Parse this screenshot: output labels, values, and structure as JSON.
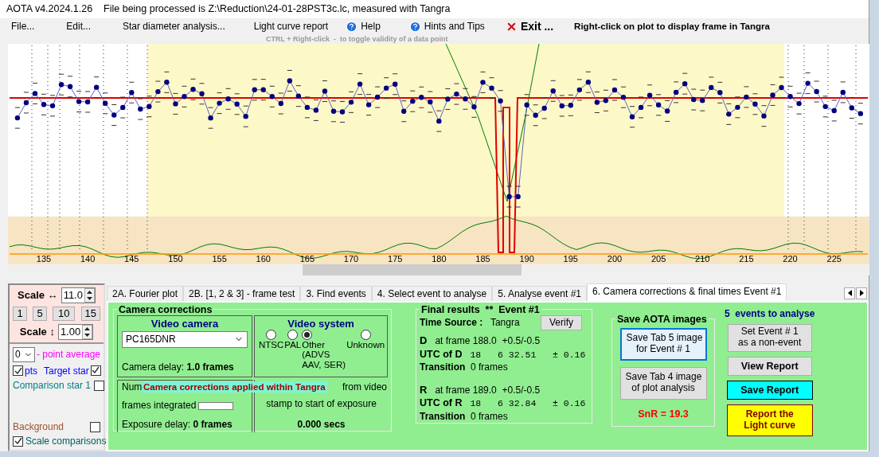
{
  "window": {
    "title": "AOTA v4.2024.1.26    File being processed is Z:\\Reduction\\24-01-28PST3c.lc, measured with Tangra"
  },
  "menu": [
    {
      "label": "File...",
      "kind": "plain"
    },
    {
      "label": "Edit...",
      "kind": "plain"
    },
    {
      "label": "Star diameter analysis...",
      "kind": "plain"
    },
    {
      "label": "Light curve report",
      "kind": "plain"
    },
    {
      "label": "Help",
      "kind": "help"
    },
    {
      "label": "Hints and Tips",
      "kind": "help"
    },
    {
      "label": "Exit ...",
      "kind": "exit"
    }
  ],
  "plot_hint": "Right-click on plot to display frame in Tangra",
  "toggle_hint": "CTRL + Right-click  -  to toggle validity of a data point",
  "plot": {
    "x_axis_labels": [
      "135",
      "140",
      "145",
      "150",
      "155",
      "160",
      "165",
      "170",
      "175",
      "180",
      "185",
      "190",
      "195",
      "200",
      "205",
      "210",
      "215",
      "220",
      "225"
    ]
  },
  "scale_panel": {
    "horizontal_label": "Scale ↔",
    "horizontal_value": "11.0",
    "presets": [
      "1",
      "5",
      "10",
      "15"
    ],
    "vertical_label": "Scale ↕",
    "vertical_value": "1.00"
  },
  "series_panel": {
    "point_average": "0",
    "point_average_label": "- point average",
    "pts_label": "pts",
    "pts_checked": true,
    "stars": [
      {
        "label": "Target star",
        "checked": true,
        "color": "#0000ff"
      },
      {
        "label": "Comparison star 1",
        "checked": false,
        "color": "#008080"
      },
      {
        "label": "Background",
        "checked": false,
        "color": "#a0522d"
      }
    ],
    "scale_comparisons": {
      "label": "Scale comparisons",
      "checked": true
    }
  },
  "tabs": [
    {
      "label": "2A. Fourier plot",
      "selected": false
    },
    {
      "label": "2B. [1, 2 & 3] - frame test",
      "selected": false
    },
    {
      "label": "3. Find events",
      "selected": false
    },
    {
      "label": "4. Select event to analyse",
      "selected": false
    },
    {
      "label": "5. Analyse event #1",
      "selected": false
    },
    {
      "label": "6. Camera corrections & final times Event #1",
      "selected": true
    }
  ],
  "camera_corrections": {
    "title": "Camera corrections",
    "video_camera": {
      "title": "Video camera",
      "value": "PC165DNR",
      "delay_label": "Camera delay:",
      "delay_value": "1.0 frames"
    },
    "video_system": {
      "title": "Video system",
      "options": [
        {
          "label": "NTSC",
          "selected": false
        },
        {
          "label": "PAL",
          "selected": false
        },
        {
          "label": "Other\n(ADVS\nAAV, SER)",
          "selected": true
        },
        {
          "label": "Unknown",
          "selected": false
        }
      ]
    },
    "integration": {
      "label_start": "Num",
      "label_rest": "frames integrated",
      "exposure_label": "Exposure delay:",
      "exposure_value": "0 frames"
    },
    "offset": {
      "text_lines": [
        "from video",
        "stamp to start of exposure"
      ],
      "value": "0.000 secs"
    },
    "overlay": "Camera corrections applied within Tangra"
  },
  "final_results": {
    "title": "Final results  **  Event #1",
    "time_source_label": "Time Source :",
    "time_source": "Tangra",
    "verify": "Verify",
    "events": [
      {
        "label": "D",
        "frame": "at frame 188.0  +0.5/-0.5",
        "utc_label": "UTC of D",
        "utc": "18   6 32.51   ± 0.16",
        "transition_label": "Transition",
        "transition": "0 frames"
      },
      {
        "label": "R",
        "frame": "at frame 189.0  +0.5/-0.5",
        "utc_label": "UTC of R",
        "utc": "18   6 32.84   ± 0.16",
        "transition_label": "Transition",
        "transition": "0 frames"
      }
    ]
  },
  "save_images": {
    "title": "Save AOTA images",
    "buttons": [
      {
        "label": "Save Tab 5 image\nfor Event # 1",
        "selected": true
      },
      {
        "label": "Save Tab 4 image\nof plot analysis",
        "selected": false
      }
    ],
    "snr": "SnR = 19.3"
  },
  "events_count": "5  events to analyse",
  "actions": [
    {
      "label": "Set Event # 1\nas a non-event",
      "kind": "plain"
    },
    {
      "label": "View Report",
      "kind": "bold"
    },
    {
      "label": "Save Report",
      "kind": "cyan"
    },
    {
      "label": "Report the\nLight curve",
      "kind": "yellow"
    }
  ]
}
